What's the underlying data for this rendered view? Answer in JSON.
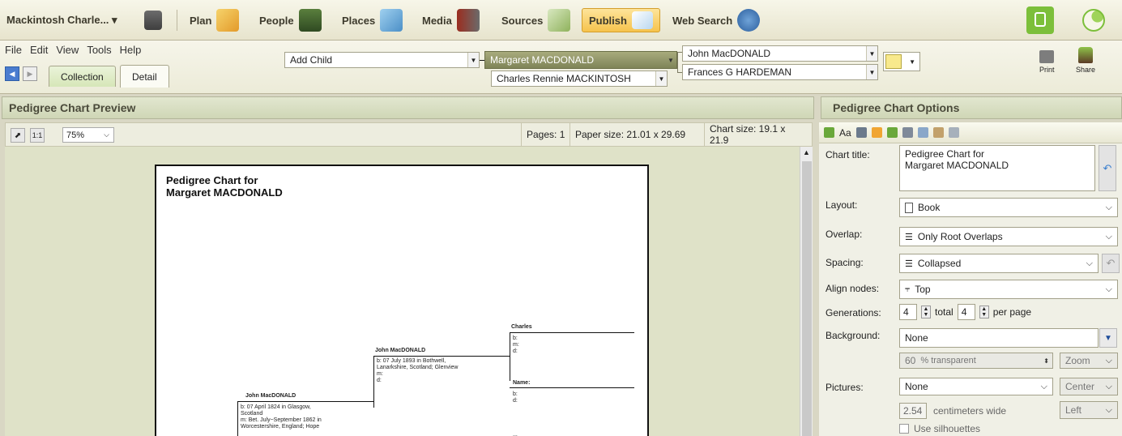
{
  "workspace": {
    "file_name": "Mackintosh Charle... ▾",
    "views": [
      {
        "label": "Plan",
        "icon": "plan-icon"
      },
      {
        "label": "People",
        "icon": "people-icon"
      },
      {
        "label": "Places",
        "icon": "places-icon"
      },
      {
        "label": "Media",
        "icon": "media-icon"
      },
      {
        "label": "Sources",
        "icon": "sources-icon"
      },
      {
        "label": "Publish",
        "icon": "publish-icon"
      },
      {
        "label": "Web Search",
        "icon": "web-search-icon"
      }
    ]
  },
  "menu": [
    "File",
    "Edit",
    "View",
    "Tools",
    "Help"
  ],
  "tabs": {
    "collection": "Collection",
    "detail": "Detail"
  },
  "family_nav": {
    "add_child": "Add Child",
    "focus_person": "Margaret MACDONALD",
    "spouse": "Charles Rennie MACKINTOSH",
    "father": "John MacDONALD",
    "mother": "Frances G HARDEMAN"
  },
  "actions": {
    "print": "Print",
    "share": "Share"
  },
  "preview": {
    "header": "Pedigree Chart Preview",
    "zoom": "75%",
    "pages": "Pages:  1",
    "paper_size": "Paper size:  21.01 x 29.69",
    "chart_size": "Chart size:  19.1 x 21.9",
    "page_title_line1": "Pedigree Chart for",
    "page_title_line2": "Margaret MACDONALD",
    "people": {
      "gen3_top": {
        "name": "Charles",
        "b": "b:",
        "m": "m:",
        "d": "d:"
      },
      "gen2": {
        "name": "John MacDONALD",
        "b": "b: 07 July 1893 in Bothwell,",
        "b2": "Lanarkshire, Scotland; Glenview",
        "m": "m:",
        "d": "d:"
      },
      "gen3_bottom": {
        "name": "Name:",
        "b": "b:",
        "d": "d:"
      },
      "gen1": {
        "name": "John MacDONALD",
        "b": "b: 07 April 1824 in Glasgow,",
        "b2": "Scotland",
        "m": "m: Bet. July~September 1862 in",
        "m2": "Worcestershire, England; Hope"
      },
      "ellipsis": "..."
    }
  },
  "options": {
    "header": "Pedigree Chart Options",
    "chart_title_label": "Chart title:",
    "chart_title_line1": "Pedigree Chart for",
    "chart_title_line2": "Margaret MACDONALD",
    "layout_label": "Layout:",
    "layout_value": "Book",
    "overlap_label": "Overlap:",
    "overlap_value": "Only Root Overlaps",
    "spacing_label": "Spacing:",
    "spacing_value": "Collapsed",
    "align_label": "Align nodes:",
    "align_value": "Top",
    "generations_label": "Generations:",
    "generations_total": "4",
    "total_text": "total",
    "generations_per_page": "4",
    "per_page_text": "per page",
    "background_label": "Background:",
    "background_value": "None",
    "transparent_value": "60",
    "transparent_text": "% transparent",
    "zoom_value": "Zoom",
    "pictures_label": "Pictures:",
    "pictures_value": "None",
    "center_value": "Center",
    "width_value": "2.54",
    "width_text": "centimeters wide",
    "left_value": "Left",
    "silhouettes_label": "Use silhouettes"
  },
  "colors": {
    "accent_green": "#7cbf3a",
    "publish_bg": "#f6c34d",
    "selection": "#8a8f63"
  }
}
